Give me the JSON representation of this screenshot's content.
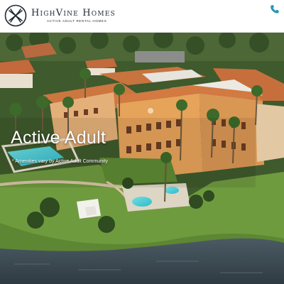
{
  "header": {
    "brand_name": "HighVine Homes",
    "brand_tagline": "ACTIVE ADULT RENTAL HOMES",
    "phone_icon": "phone-icon",
    "logo_icon": "vine-logo-icon",
    "accent_color": "#2a93b5"
  },
  "hero": {
    "title": "Active Adult",
    "subtitle": "* Amenities vary by Active Adult Community",
    "image": "aerial-resort-community-photo"
  }
}
